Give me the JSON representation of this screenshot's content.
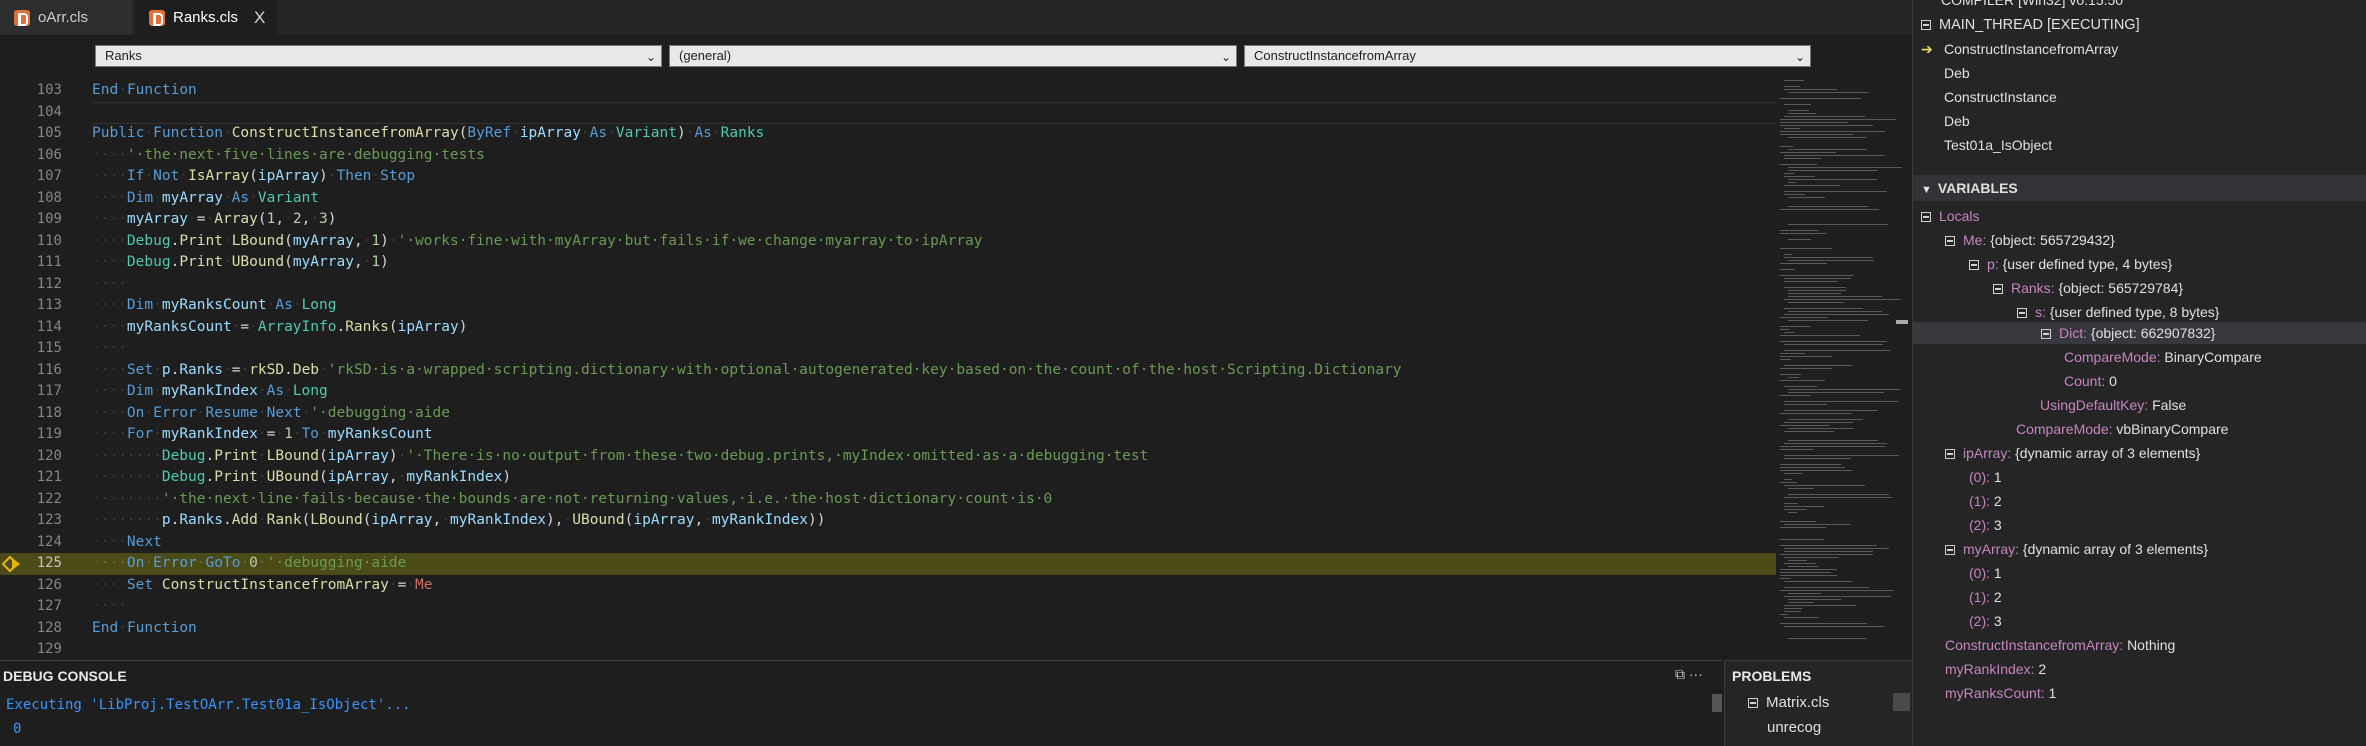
{
  "tabs": [
    {
      "label": "oArr.cls"
    },
    {
      "label": "Ranks.cls",
      "close": "X"
    }
  ],
  "dropdowns": {
    "module": "Ranks",
    "object": "(general)",
    "procedure": "ConstructInstancefromArray"
  },
  "editor": {
    "current_line": "125"
  },
  "debug_console": {
    "title": "DEBUG CONSOLE",
    "icons": "⧉ ···",
    "lines": [
      "Executing 'LibProj.TestOArr.Test01a_IsObject'...",
      "0"
    ]
  },
  "problems": {
    "title": "PROBLEMS",
    "file": "Matrix.cls",
    "item": "unrecog"
  },
  "call_stack": {
    "header_partial": "COMPILER [Win32] v0.15.50",
    "thread": "MAIN_THREAD [EXECUTING]",
    "frames": [
      "ConstructInstancefromArray",
      "Deb",
      "ConstructInstance",
      "Deb",
      "Test01a_IsObject"
    ]
  },
  "variables": {
    "header": "VARIABLES",
    "locals_label": "Locals",
    "rows": [
      {
        "name": "Me:",
        "value": "{object: 565729432}"
      },
      {
        "name": "p:",
        "value": "{user defined type, 4 bytes}"
      },
      {
        "name": "Ranks:",
        "value": "{object: 565729784}"
      },
      {
        "name": "s:",
        "value": "{user defined type, 8 bytes}"
      },
      {
        "name": "Dict:",
        "value": "{object: 662907832}"
      },
      {
        "name": "CompareMode:",
        "value": "BinaryCompare"
      },
      {
        "name": "Count:",
        "value": "0"
      },
      {
        "name": "UsingDefaultKey:",
        "value": "False"
      },
      {
        "name": "CompareMode:",
        "value": "vbBinaryCompare"
      },
      {
        "name": "ipArray:",
        "value": "{dynamic array of 3 elements}"
      },
      {
        "name": "(0):",
        "value": "1"
      },
      {
        "name": "(1):",
        "value": "2"
      },
      {
        "name": "(2):",
        "value": "3"
      },
      {
        "name": "myArray:",
        "value": "{dynamic array of 3 elements}"
      },
      {
        "name": "(0):",
        "value": "1"
      },
      {
        "name": "(1):",
        "value": "2"
      },
      {
        "name": "(2):",
        "value": "3"
      },
      {
        "name": "ConstructInstancefromArray:",
        "value": "Nothing"
      },
      {
        "name": "myRankIndex:",
        "value": "2"
      },
      {
        "name": "myRanksCount:",
        "value": "1"
      }
    ]
  },
  "colors": {
    "accent_highlight_line": "#4b4b18",
    "breakpoint": "#e8b60b",
    "keyword": "#569cd6",
    "function": "#dcdcaa",
    "comment": "#6a9955",
    "variable_name": "#c586c0"
  }
}
